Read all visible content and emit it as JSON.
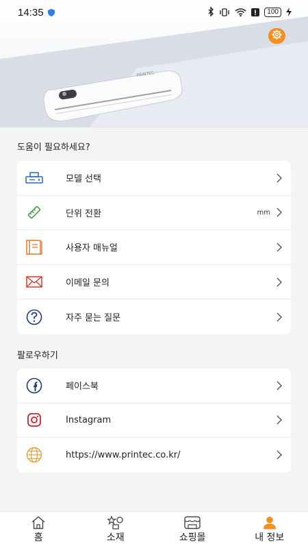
{
  "status_bar": {
    "time": "14:35",
    "battery": "100",
    "icons": [
      "shield-icon",
      "bluetooth-icon",
      "vibrate-icon",
      "wifi-icon",
      "alert-icon",
      "battery-icon",
      "charging-icon"
    ]
  },
  "header": {
    "product_image": "printer-device",
    "settings_icon": "gear-icon",
    "accent": "#f5901f"
  },
  "help": {
    "title": "도움이 필요하세요?",
    "items": [
      {
        "icon": "printer-icon",
        "label": "모델 선택",
        "value": ""
      },
      {
        "icon": "ruler-icon",
        "label": "단위 전환",
        "value": "mm"
      },
      {
        "icon": "manual-icon",
        "label": "사용자 매뉴얼",
        "value": ""
      },
      {
        "icon": "mail-icon",
        "label": "이메일 문의",
        "value": ""
      },
      {
        "icon": "question-icon",
        "label": "자주 묻는 질문",
        "value": ""
      }
    ]
  },
  "follow": {
    "title": "팔로우하기",
    "items": [
      {
        "icon": "facebook-icon",
        "label": "페이스북"
      },
      {
        "icon": "instagram-icon",
        "label": "Instagram"
      },
      {
        "icon": "globe-icon",
        "label": "https://www.printec.co.kr/"
      }
    ]
  },
  "nav": {
    "items": [
      {
        "icon": "home-icon",
        "label": "홈"
      },
      {
        "icon": "material-icon",
        "label": "소재"
      },
      {
        "icon": "shop-icon",
        "label": "쇼핑몰"
      },
      {
        "icon": "user-icon",
        "label": "내 정보",
        "active": true
      }
    ],
    "active_color": "#f5901f"
  }
}
